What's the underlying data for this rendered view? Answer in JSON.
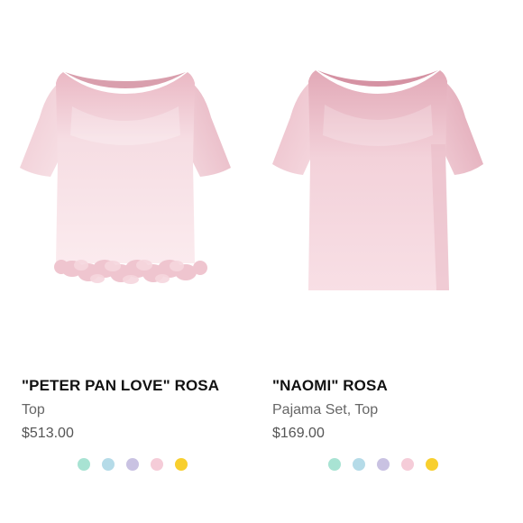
{
  "products": [
    {
      "name": "\"PETER PAN LOVE\" ROSA",
      "category": "Top",
      "price": "$513.00",
      "image": "pink-satin-top-feather-trim",
      "swatches": [
        {
          "label": "mint",
          "color": "#a8e3d3"
        },
        {
          "label": "light-blue",
          "color": "#b5dbe8"
        },
        {
          "label": "lavender",
          "color": "#c9c2e2"
        },
        {
          "label": "pink",
          "color": "#f5ccd8"
        },
        {
          "label": "yellow",
          "color": "#f8cf2e"
        }
      ]
    },
    {
      "name": "\"NAOMI\" ROSA",
      "category": "Pajama Set, Top",
      "price": "$169.00",
      "image": "pink-satin-top",
      "swatches": [
        {
          "label": "mint",
          "color": "#a8e3d3"
        },
        {
          "label": "light-blue",
          "color": "#b5dbe8"
        },
        {
          "label": "lavender",
          "color": "#c9c2e2"
        },
        {
          "label": "pink",
          "color": "#f5ccd8"
        },
        {
          "label": "yellow",
          "color": "#f8cf2e"
        }
      ]
    }
  ],
  "colors": {
    "satin_light": "#f7e2e7",
    "satin_mid": "#ecc4cf",
    "satin_dark": "#dca7b5",
    "feather": "#eec3cd"
  }
}
